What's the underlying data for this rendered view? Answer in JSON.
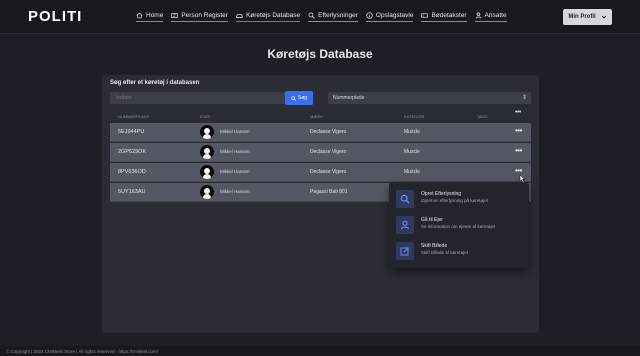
{
  "brand": {
    "logo": "POLITI"
  },
  "nav": [
    {
      "label": "Home",
      "icon": "home-icon",
      "active": false
    },
    {
      "label": "Person Register",
      "icon": "id-card-icon",
      "active": false
    },
    {
      "label": "Køretøjs Database",
      "icon": "car-icon",
      "active": true
    },
    {
      "label": "Efterlysninger",
      "icon": "search-icon",
      "active": false
    },
    {
      "label": "Opslagstavle",
      "icon": "info-icon",
      "active": false
    },
    {
      "label": "Bødetakster",
      "icon": "ticket-icon",
      "active": false
    },
    {
      "label": "Ansatte",
      "icon": "user-icon",
      "active": false
    }
  ],
  "profile": {
    "label": "Min Profil"
  },
  "page": {
    "title": "Køretøjs Database"
  },
  "panel": {
    "title": "Søg efter et køretøj i databasen",
    "search_placeholder": "Indtast",
    "search_button": "Søg",
    "category_value": "Nummerplade"
  },
  "table": {
    "headers": [
      "Nummerplade",
      "Ejer",
      "Mærk",
      "Kategori",
      "Tags"
    ],
    "more_label": "•••",
    "rows": [
      {
        "plate": "5EJ944PU",
        "owner": "Mikkel Hansen",
        "model": "Declasse Vigero",
        "category": "Muscle"
      },
      {
        "plate": "2GP529OK",
        "owner": "Mikkel Hansen",
        "model": "Declasse Vigero",
        "category": "Muscle"
      },
      {
        "plate": "8PV636OD",
        "owner": "Mikkel Hansen",
        "model": "Declasse Vigero",
        "category": "Muscle"
      },
      {
        "plate": "5UY163AU",
        "owner": "Mikkel Hansen",
        "model": "Pegassi Bati 801",
        "category": ""
      }
    ]
  },
  "context_menu": {
    "items": [
      {
        "title": "Opret Efterlysning",
        "subtitle": "Opret en efterlysning på køretøjet",
        "icon": "search-icon"
      },
      {
        "title": "Gå til Ejer",
        "subtitle": "Se information om ejeren af køretøjet",
        "icon": "user-icon"
      },
      {
        "title": "Skift Billede",
        "subtitle": "Skift billede af køretøjet",
        "icon": "edit-icon"
      }
    ]
  },
  "footer": {
    "text": "© Copyright | 2022 CMikkels Store | All rights reserved - https://cmikkel.com/"
  },
  "colors": {
    "accent": "#3d6ef0",
    "background": "#1d1f26",
    "panel": "#2a2d36",
    "row": "#545864"
  }
}
